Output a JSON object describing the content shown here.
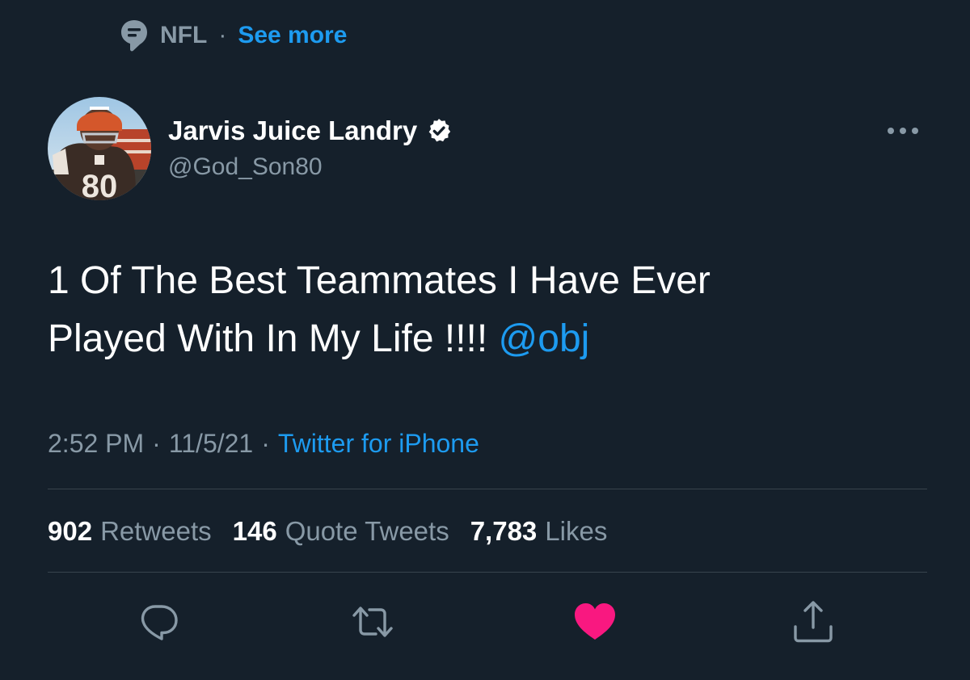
{
  "topic": {
    "name": "NFL",
    "separator": "·",
    "see_more": "See more"
  },
  "author": {
    "display_name": "Jarvis Juice Landry",
    "handle": "@God_Son80",
    "verified": true,
    "avatar_jersey_number": "80"
  },
  "tweet": {
    "text_line1": "1 Of The Best Teammates I Have Ever",
    "text_line2": "Played With In My Life !!!! ",
    "mention": "@obj"
  },
  "meta": {
    "time": "2:52 PM",
    "sep1": "·",
    "date": "11/5/21",
    "sep2": "·",
    "source": "Twitter for iPhone"
  },
  "stats": {
    "retweets_count": "902",
    "retweets_label": "Retweets",
    "quotes_count": "146",
    "quotes_label": "Quote Tweets",
    "likes_count": "7,783",
    "likes_label": "Likes"
  },
  "actions": {
    "reply_icon": "reply-icon",
    "retweet_icon": "retweet-icon",
    "like_icon": "heart-icon",
    "like_active": true,
    "share_icon": "share-icon"
  },
  "colors": {
    "background": "#15202b",
    "accent": "#1d9bf0",
    "muted": "#8899a6",
    "like": "#f91880",
    "divider": "#38444d"
  }
}
